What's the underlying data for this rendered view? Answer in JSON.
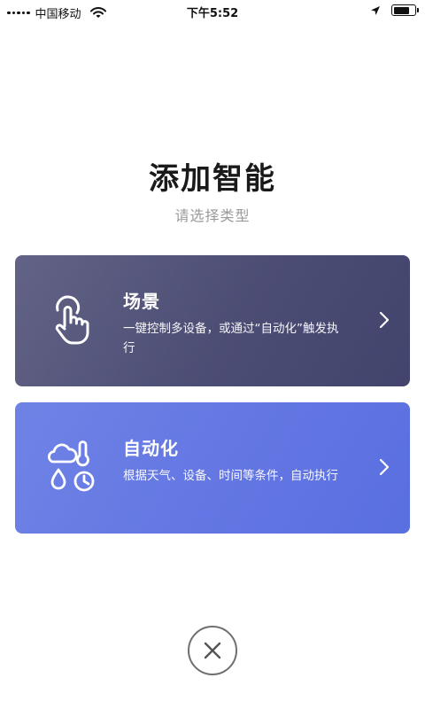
{
  "status_bar": {
    "carrier": "中国移动",
    "time": "下午5:52",
    "battery_level": 0.8
  },
  "header": {
    "title": "添加智能",
    "subtitle": "请选择类型"
  },
  "cards": [
    {
      "title": "场景",
      "description": "一键控制多设备，或通过“自动化”触发执行",
      "icon": "tap-gesture-icon",
      "color": "#4f5077"
    },
    {
      "title": "自动化",
      "description": "根据天气、设备、时间等条件，自动执行",
      "icon": "weather-time-icon",
      "color": "#6579e3"
    }
  ],
  "close": {
    "icon": "close-icon"
  }
}
